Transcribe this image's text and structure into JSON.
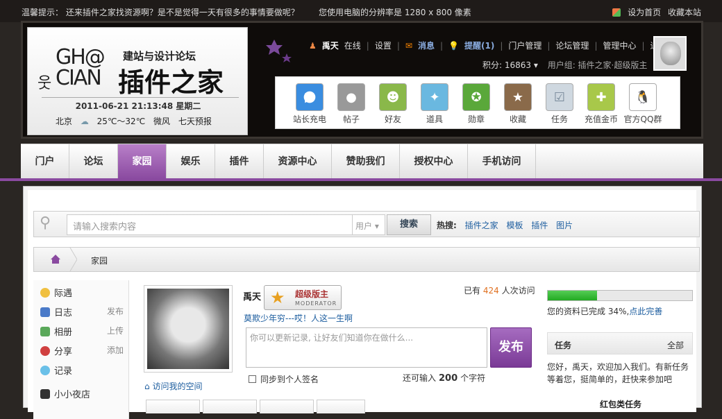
{
  "topbar": {
    "tip": "温馨提示： 还来插件之家找资源啊？是不是觉得一天有很多的事情要做呢？",
    "resolution": "您使用电脑的分辨率是 1280 x 800 像素",
    "set_home": "设为首页",
    "bookmark": "收藏本站"
  },
  "logo": {
    "tagline": "建站与设计论坛",
    "mark_line1": "GH@",
    "mark_line2": "CIAN",
    "name": "插件之家",
    "date": "2011-06-21 21:13:48 星期二",
    "city": "北京",
    "temp": "25℃～32℃",
    "wind": "微风",
    "forecast": "七天预报"
  },
  "userbar": {
    "username": "禹天",
    "status": "在线",
    "settings": "设置",
    "messages": "消息",
    "reminders": "提醒(1)",
    "portal_admin": "门户管理",
    "forum_admin": "论坛管理",
    "admin_center": "管理中心",
    "logout": "退出",
    "points": "积分: 16863",
    "group": "用户组: 插件之家·超级版主"
  },
  "tools": [
    {
      "label": "站长充电",
      "icon": "play-icon"
    },
    {
      "label": "帖子",
      "icon": "chat-bubble-icon"
    },
    {
      "label": "好友",
      "icon": "friends-icon"
    },
    {
      "label": "道具",
      "icon": "magic-wand-icon"
    },
    {
      "label": "勋章",
      "icon": "medal-icon"
    },
    {
      "label": "收藏",
      "icon": "star-icon"
    },
    {
      "label": "任务",
      "icon": "checklist-icon"
    },
    {
      "label": "充值金币",
      "icon": "coins-icon"
    },
    {
      "label": "官方QQ群",
      "icon": "penguin-icon"
    }
  ],
  "nav": [
    "门户",
    "论坛",
    "家园",
    "娱乐",
    "插件",
    "资源中心",
    "赞助我们",
    "授权中心",
    "手机访问"
  ],
  "search": {
    "placeholder": "请输入搜索内容",
    "scope": "用户",
    "button": "搜索",
    "hot_label": "热搜:",
    "hot": [
      "插件之家",
      "模板",
      "插件",
      "图片"
    ]
  },
  "breadcrumb": {
    "current": "家园"
  },
  "sidebar": [
    {
      "label": "际遇",
      "action": ""
    },
    {
      "label": "日志",
      "action": "发布"
    },
    {
      "label": "相册",
      "action": "上传"
    },
    {
      "label": "分享",
      "action": "添加"
    },
    {
      "label": "记录",
      "action": ""
    },
    {
      "label": "小小夜店",
      "action": ""
    }
  ],
  "profile": {
    "name": "禹天",
    "badge_title": "超级版主",
    "badge_sub": "MODERATOR",
    "visits_prefix": "已有",
    "visits_count": "424",
    "visits_suffix": "人次访问",
    "motto": "莫欺少年穷---哎！人这一生啊",
    "visit_space": "访问我的空间"
  },
  "composer": {
    "placeholder": "你可以更新记录, 让好友们知道你在做什么...",
    "publish": "发布",
    "sync": "同步到个人签名",
    "remain_prefix": "还可输入",
    "remain_count": "200",
    "remain_suffix": "个字符"
  },
  "right": {
    "progress": 0.34,
    "progress_text": "您的资料已完成 34%,",
    "progress_link": "点此完善",
    "task_title": "任务",
    "task_all": "全部",
    "task_desc": "您好，禹天，欢迎加入我们。有新任务等着您，挺简单的，赶快来参加吧",
    "redpack": "红包类任务"
  },
  "colors": {
    "accent": "#8a4aa0",
    "link": "#1c5d9f",
    "count": "#e07020"
  }
}
